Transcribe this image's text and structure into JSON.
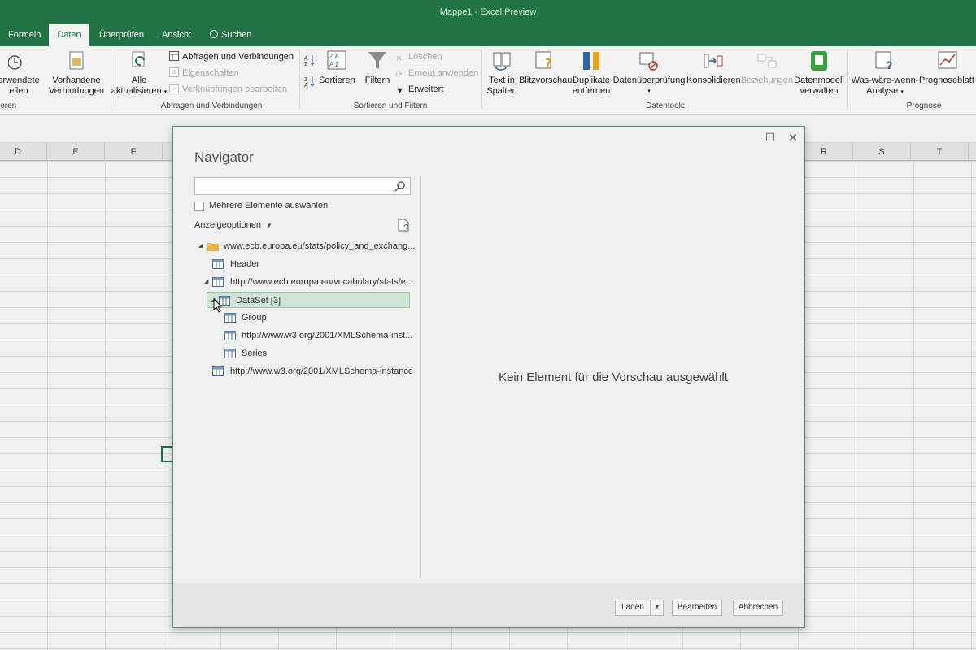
{
  "window": {
    "title": "Mappe1  -  Excel Preview"
  },
  "tabs": [
    {
      "label": "Formeln"
    },
    {
      "label": "Daten",
      "active": true
    },
    {
      "label": "Überprüfen"
    },
    {
      "label": "Ansicht"
    },
    {
      "label": "Suchen",
      "icon": "lightbulb-icon"
    }
  ],
  "ribbon": {
    "get_transform": {
      "line1": "erwendete",
      "line2": "ellen",
      "group_label": "ieren"
    },
    "existing_connections": {
      "line1": "Vorhandene",
      "line2": "Verbindungen"
    },
    "queries": {
      "refresh_all": {
        "line1": "Alle",
        "line2": "aktualisieren"
      },
      "queries_connections": "Abfragen und Verbindungen",
      "properties": "Eigenschaften",
      "edit_links": "Verknüpfungen bearbeiten",
      "group_label": "Abfragen und Verbindungen"
    },
    "sort_filter": {
      "sort": "Sortieren",
      "filter": "Filtern",
      "clear": "Löschen",
      "reapply": "Erneut anwenden",
      "advanced": "Erweitert",
      "group_label": "Sortieren und Filtern"
    },
    "data_tools": {
      "text_to_columns": {
        "line1": "Text in",
        "line2": "Spalten"
      },
      "flash_fill": "Blitzvorschau",
      "remove_duplicates": {
        "line1": "Duplikate",
        "line2": "entfernen"
      },
      "data_validation": "Datenüberprüfung",
      "consolidate": "Konsolidieren",
      "relationships": "Beziehungen",
      "manage_data_model": {
        "line1": "Datenmodell",
        "line2": "verwalten"
      },
      "group_label": "Datentools"
    },
    "forecast": {
      "what_if": {
        "line1": "Was-wäre-wenn-",
        "line2": "Analyse"
      },
      "forecast_sheet": "Prognoseblatt",
      "group_label": "Prognose"
    }
  },
  "sheet": {
    "columns_left": [
      "D",
      "E",
      "F"
    ],
    "columns_right": [
      "R",
      "S",
      "T"
    ]
  },
  "navigator": {
    "title": "Navigator",
    "search_placeholder": "",
    "multi_select_label": "Mehrere Elemente auswählen",
    "display_options": "Anzeigeoptionen",
    "tree": [
      {
        "label": "www.ecb.europa.eu/stats/policy_and_exchang...",
        "type": "folder",
        "expanded": true
      },
      {
        "label": "Header",
        "type": "table"
      },
      {
        "label": "http://www.ecb.europa.eu/vocabulary/stats/e...",
        "type": "table",
        "expanded": true
      },
      {
        "label": "DataSet [3]",
        "type": "table",
        "expanded": true,
        "selected": true
      },
      {
        "label": "Group",
        "type": "table"
      },
      {
        "label": "http://www.w3.org/2001/XMLSchema-inst...",
        "type": "table"
      },
      {
        "label": "Series",
        "type": "table"
      },
      {
        "label": "http://www.w3.org/2001/XMLSchema-instance",
        "type": "table"
      }
    ],
    "preview_message": "Kein Element für die Vorschau ausgewählt",
    "buttons": {
      "load": "Laden",
      "edit": "Bearbeiten",
      "cancel": "Abbrechen"
    }
  },
  "colors": {
    "accent": "#217346",
    "selection": "#cfe5d5"
  }
}
